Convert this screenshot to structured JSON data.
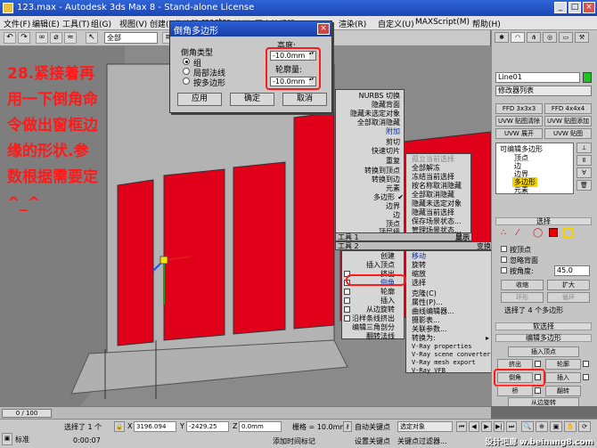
{
  "window": {
    "title": "123.max - Autodesk 3ds Max 8 - Stand-alone License"
  },
  "menubar": [
    "文件(F)",
    "编辑(E)",
    "工具(T)",
    "组(G)",
    "视图(V)",
    "创建(C)",
    "修改器",
    "reactor",
    "动画",
    "图表编辑器",
    "渲染(R)",
    "自定义(U)",
    "MAXScript(M)",
    "帮助(H)"
  ],
  "toolbar": {
    "selection_filter": "全部"
  },
  "annotation": {
    "lines": [
      "28.紧接着再",
      "用一下倒角命",
      "令做出窗框边",
      "缘的形状.参",
      "数根据需要定",
      "^_^"
    ]
  },
  "dialog": {
    "title": "倒角多边形",
    "group_label": "倒角类型",
    "options": [
      "组",
      "局部法线",
      "按多边形"
    ],
    "selected_option": 0,
    "height_label": "高度:",
    "height_value": "-10.0mm",
    "outline_label": "轮廓量:",
    "outline_value": "-10.0mm",
    "buttons": {
      "apply": "应用",
      "ok": "确定",
      "cancel": "取消"
    }
  },
  "quad_display": {
    "left": [
      "NURBS 切换",
      "隐藏背面",
      "隐藏未选定对象",
      "全部取消隐藏",
      "附加",
      "剪切",
      "快速切片",
      "重复",
      "转换到顶点",
      "转换到边",
      "元素",
      "多边形",
      "边界",
      "边",
      "顶点",
      "顶层级"
    ],
    "right": [
      "孤立当前选择",
      "全部解冻",
      "冻结当前选择",
      "按名称取消隐藏",
      "全部取消隐藏",
      "隐藏未选定对象",
      "隐藏当前选择",
      "保存场景状态...",
      "管理场景状态..."
    ],
    "header_left": "工具 1",
    "header_right": "显示"
  },
  "quad_transform": {
    "left": [
      "创建",
      "插入顶点",
      "挤出",
      "倒角",
      "轮廓",
      "插入",
      "从边旋转",
      "沿样条线挤出",
      "编辑三角剖分",
      "翻转法线"
    ],
    "right": [
      "移动",
      "旋转",
      "缩放",
      "选择",
      "克隆(C)",
      "属性(P)...",
      "曲线编辑器...",
      "摄影表...",
      "关联参数...",
      "转换为:",
      "V-Ray properties",
      "V-Ray scene converter",
      "V-Ray mesh export",
      "V-Ray VFB"
    ],
    "header_left": "工具 2",
    "header_right": "变换"
  },
  "panel": {
    "object_name": "Line01",
    "modifier_list": "修改器列表",
    "buttons": [
      "FFD 3x3x3",
      "FFD 4x4x4",
      "UVW 贴图清除",
      "UVW 贴图添加",
      "UVW 展开",
      "UVW 贴图"
    ],
    "stack": [
      "可编辑多边形",
      "顶点",
      "边",
      "边界",
      "多边形",
      "元素"
    ],
    "select_rollout": "选择",
    "by_vertex": "按顶点",
    "ignore_backface": "忽略背面",
    "by_angle": "按角度:",
    "angle_value": "45.0",
    "shrink": "收缩",
    "grow": "扩大",
    "ring": "环形",
    "loop": "循环",
    "selected_info": "选择了 4 个多边形",
    "soft_select": "软选择",
    "edit_poly_rollout": "编辑多边形",
    "insert_vertex": "插入顶点",
    "extrude": "挤出",
    "outline": "轮廓",
    "bevel": "倒角",
    "inset": "插入",
    "bridge": "桥",
    "flip": "翻转",
    "hinge": "从边旋转"
  },
  "timeline": {
    "frame": "0 / 100"
  },
  "status": {
    "selected": "选择了 1 个",
    "time": "0:00:07",
    "x": "3196.094",
    "y": "-2429.25",
    "z": "0.0mm",
    "grid": "栅格 = 10.0mm",
    "auto_key": "自动关键点",
    "set_key": "设置关键点",
    "key_filter": "关键点过滤器...",
    "selection": "选定对象",
    "add_time_tag": "添加时间标记",
    "mode_label": "标准"
  },
  "watermark": "设计吧廊 w.beinang8.com"
}
